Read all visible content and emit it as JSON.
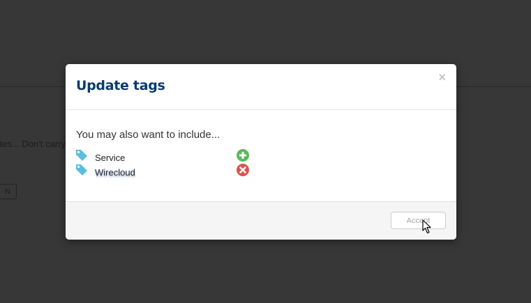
{
  "background": {
    "partial_text": "tes... Don't carry",
    "partial_button": "N"
  },
  "modal": {
    "title": "Update tags",
    "close_label": "×",
    "suggestion_heading": "You may also want to include...",
    "tags": [
      {
        "label": "Service",
        "icon": "tag-icon",
        "action": "add-icon",
        "action_color": "#5cb85c"
      },
      {
        "label": "Wirecloud",
        "icon": "tag-icon",
        "action": "remove-icon",
        "action_color": "#d9534f"
      }
    ],
    "accept_label": "Accept"
  },
  "colors": {
    "title": "#0b3b6e",
    "tag_icon": "#5bc0de",
    "overlay": "#343434"
  }
}
